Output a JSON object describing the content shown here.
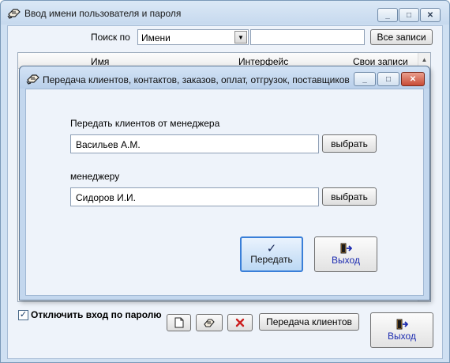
{
  "window": {
    "title": "Ввод имени пользователя и пароля",
    "icon": "pencil-hand-icon",
    "controls": {
      "minimize": "_",
      "maximize": "□",
      "close": "✕"
    }
  },
  "search": {
    "label": "Поиск по",
    "field_value": "Имени",
    "text_value": "",
    "all_records_label": "Все записи"
  },
  "grid": {
    "columns": [
      "Имя",
      "Интерфейс",
      "Свои записи"
    ]
  },
  "bottom": {
    "disable_password_checked": true,
    "disable_password_label": "Отключить вход по паролю",
    "toolbar_icons": [
      "new-document-icon",
      "edit-icon",
      "delete-icon"
    ],
    "transfer_clients_label": "Передача клиентов",
    "exit_label": "Выход"
  },
  "dialog": {
    "title": "Передача клиентов, контактов, заказов, оплат, отгрузок, поставщиков",
    "from_label": "Передать клиентов от менеджера",
    "from_value": "Васильев А.М.",
    "from_choose_label": "выбрать",
    "to_label": "менеджеру",
    "to_value": "Сидоров И.И.",
    "to_choose_label": "выбрать",
    "transfer_label": "Передать",
    "exit_label": "Выход",
    "accent_color": "#3a7fd8"
  }
}
